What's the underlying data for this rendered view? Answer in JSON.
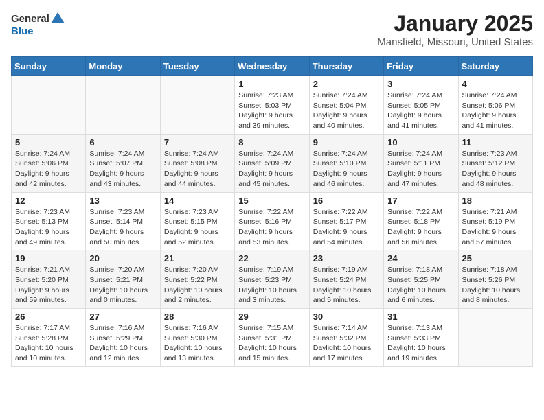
{
  "header": {
    "logo_general": "General",
    "logo_blue": "Blue",
    "title": "January 2025",
    "subtitle": "Mansfield, Missouri, United States"
  },
  "days_of_week": [
    "Sunday",
    "Monday",
    "Tuesday",
    "Wednesday",
    "Thursday",
    "Friday",
    "Saturday"
  ],
  "weeks": [
    [
      {
        "day": "",
        "info": ""
      },
      {
        "day": "",
        "info": ""
      },
      {
        "day": "",
        "info": ""
      },
      {
        "day": "1",
        "info": "Sunrise: 7:23 AM\nSunset: 5:03 PM\nDaylight: 9 hours\nand 39 minutes."
      },
      {
        "day": "2",
        "info": "Sunrise: 7:24 AM\nSunset: 5:04 PM\nDaylight: 9 hours\nand 40 minutes."
      },
      {
        "day": "3",
        "info": "Sunrise: 7:24 AM\nSunset: 5:05 PM\nDaylight: 9 hours\nand 41 minutes."
      },
      {
        "day": "4",
        "info": "Sunrise: 7:24 AM\nSunset: 5:06 PM\nDaylight: 9 hours\nand 41 minutes."
      }
    ],
    [
      {
        "day": "5",
        "info": "Sunrise: 7:24 AM\nSunset: 5:06 PM\nDaylight: 9 hours\nand 42 minutes."
      },
      {
        "day": "6",
        "info": "Sunrise: 7:24 AM\nSunset: 5:07 PM\nDaylight: 9 hours\nand 43 minutes."
      },
      {
        "day": "7",
        "info": "Sunrise: 7:24 AM\nSunset: 5:08 PM\nDaylight: 9 hours\nand 44 minutes."
      },
      {
        "day": "8",
        "info": "Sunrise: 7:24 AM\nSunset: 5:09 PM\nDaylight: 9 hours\nand 45 minutes."
      },
      {
        "day": "9",
        "info": "Sunrise: 7:24 AM\nSunset: 5:10 PM\nDaylight: 9 hours\nand 46 minutes."
      },
      {
        "day": "10",
        "info": "Sunrise: 7:24 AM\nSunset: 5:11 PM\nDaylight: 9 hours\nand 47 minutes."
      },
      {
        "day": "11",
        "info": "Sunrise: 7:23 AM\nSunset: 5:12 PM\nDaylight: 9 hours\nand 48 minutes."
      }
    ],
    [
      {
        "day": "12",
        "info": "Sunrise: 7:23 AM\nSunset: 5:13 PM\nDaylight: 9 hours\nand 49 minutes."
      },
      {
        "day": "13",
        "info": "Sunrise: 7:23 AM\nSunset: 5:14 PM\nDaylight: 9 hours\nand 50 minutes."
      },
      {
        "day": "14",
        "info": "Sunrise: 7:23 AM\nSunset: 5:15 PM\nDaylight: 9 hours\nand 52 minutes."
      },
      {
        "day": "15",
        "info": "Sunrise: 7:22 AM\nSunset: 5:16 PM\nDaylight: 9 hours\nand 53 minutes."
      },
      {
        "day": "16",
        "info": "Sunrise: 7:22 AM\nSunset: 5:17 PM\nDaylight: 9 hours\nand 54 minutes."
      },
      {
        "day": "17",
        "info": "Sunrise: 7:22 AM\nSunset: 5:18 PM\nDaylight: 9 hours\nand 56 minutes."
      },
      {
        "day": "18",
        "info": "Sunrise: 7:21 AM\nSunset: 5:19 PM\nDaylight: 9 hours\nand 57 minutes."
      }
    ],
    [
      {
        "day": "19",
        "info": "Sunrise: 7:21 AM\nSunset: 5:20 PM\nDaylight: 9 hours\nand 59 minutes."
      },
      {
        "day": "20",
        "info": "Sunrise: 7:20 AM\nSunset: 5:21 PM\nDaylight: 10 hours\nand 0 minutes."
      },
      {
        "day": "21",
        "info": "Sunrise: 7:20 AM\nSunset: 5:22 PM\nDaylight: 10 hours\nand 2 minutes."
      },
      {
        "day": "22",
        "info": "Sunrise: 7:19 AM\nSunset: 5:23 PM\nDaylight: 10 hours\nand 3 minutes."
      },
      {
        "day": "23",
        "info": "Sunrise: 7:19 AM\nSunset: 5:24 PM\nDaylight: 10 hours\nand 5 minutes."
      },
      {
        "day": "24",
        "info": "Sunrise: 7:18 AM\nSunset: 5:25 PM\nDaylight: 10 hours\nand 6 minutes."
      },
      {
        "day": "25",
        "info": "Sunrise: 7:18 AM\nSunset: 5:26 PM\nDaylight: 10 hours\nand 8 minutes."
      }
    ],
    [
      {
        "day": "26",
        "info": "Sunrise: 7:17 AM\nSunset: 5:28 PM\nDaylight: 10 hours\nand 10 minutes."
      },
      {
        "day": "27",
        "info": "Sunrise: 7:16 AM\nSunset: 5:29 PM\nDaylight: 10 hours\nand 12 minutes."
      },
      {
        "day": "28",
        "info": "Sunrise: 7:16 AM\nSunset: 5:30 PM\nDaylight: 10 hours\nand 13 minutes."
      },
      {
        "day": "29",
        "info": "Sunrise: 7:15 AM\nSunset: 5:31 PM\nDaylight: 10 hours\nand 15 minutes."
      },
      {
        "day": "30",
        "info": "Sunrise: 7:14 AM\nSunset: 5:32 PM\nDaylight: 10 hours\nand 17 minutes."
      },
      {
        "day": "31",
        "info": "Sunrise: 7:13 AM\nSunset: 5:33 PM\nDaylight: 10 hours\nand 19 minutes."
      },
      {
        "day": "",
        "info": ""
      }
    ]
  ]
}
